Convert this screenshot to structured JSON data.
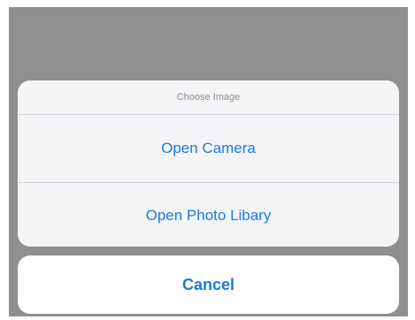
{
  "action_sheet": {
    "title": "Choose Image",
    "actions": [
      {
        "label": "Open Camera"
      },
      {
        "label": "Open Photo Libary"
      }
    ],
    "cancel_label": "Cancel"
  },
  "colors": {
    "overlay": "#8f8f8f",
    "sheet_background": "#f4f4f6",
    "cancel_background": "#ffffff",
    "action_text": "#1a7ae6",
    "title_text": "#8e8e93",
    "divider": "#d3d3d8"
  }
}
